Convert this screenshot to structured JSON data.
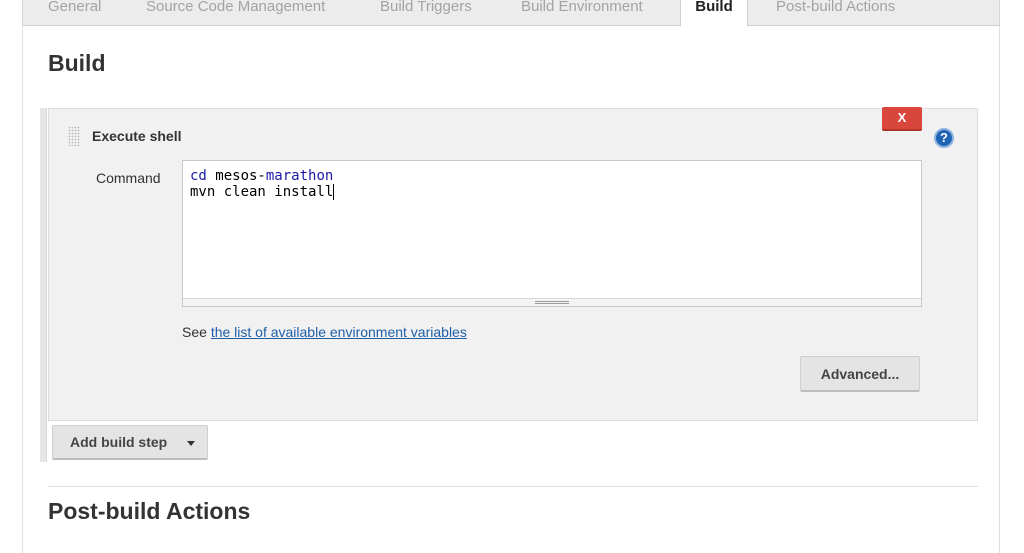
{
  "tabs": [
    {
      "label": "General",
      "active": false
    },
    {
      "label": "Source Code Management",
      "active": false
    },
    {
      "label": "Build Triggers",
      "active": false
    },
    {
      "label": "Build Environment",
      "active": false
    },
    {
      "label": "Build",
      "active": true
    },
    {
      "label": "Post-build Actions",
      "active": false
    }
  ],
  "build": {
    "title": "Build",
    "step": {
      "title": "Execute shell",
      "delete_label": "X",
      "help_label": "?",
      "command_label": "Command",
      "command_lines": [
        {
          "kw1": "cd",
          "rest1": " mesos-",
          "kw2": "marathon"
        },
        {
          "text": "mvn clean install"
        }
      ],
      "env_prefix": "See ",
      "env_link": "the list of available environment variables",
      "advanced_label": "Advanced..."
    },
    "add_step_label": "Add build step"
  },
  "post_build": {
    "title": "Post-build Actions"
  },
  "colors": {
    "accent_link": "#1f5fa8",
    "delete_red": "#d9463b",
    "help_blue": "#1f64b4",
    "keyword_blue": "#1a1aa6"
  }
}
